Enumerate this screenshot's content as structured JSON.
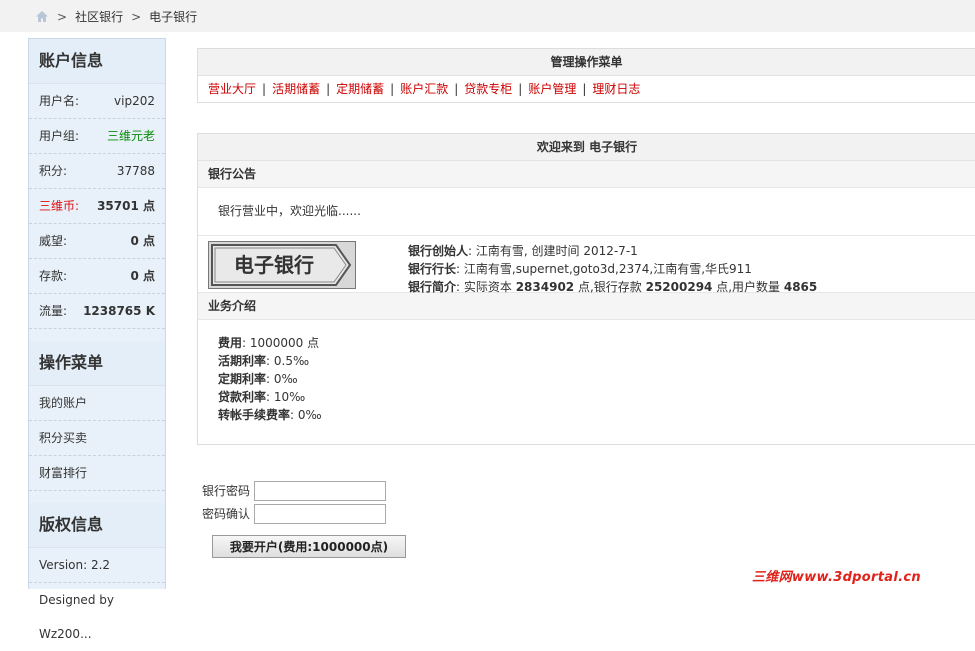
{
  "breadcrumb": {
    "items": [
      "社区银行",
      "电子银行"
    ],
    "sep": ">"
  },
  "sidebar": {
    "account": {
      "title": "账户信息",
      "rows": [
        {
          "k": "用户名:",
          "v": "vip202"
        },
        {
          "k": "用户组:",
          "v": "三维元老"
        },
        {
          "k": "积分:",
          "v": "37788"
        },
        {
          "k": "三维币:",
          "v": "35701 点"
        },
        {
          "k": "威望:",
          "v": "0 点"
        },
        {
          "k": "存款:",
          "v": "0 点"
        },
        {
          "k": "流量:",
          "v": "1238765 K"
        }
      ]
    },
    "ops": {
      "title": "操作菜单",
      "items": [
        "我的账户",
        "积分买卖",
        "财富排行"
      ]
    },
    "copyright": {
      "title": "版权信息",
      "version": "Version: 2.2",
      "designed": "Designed by Wz200..."
    }
  },
  "menu": {
    "title": "管理操作菜单",
    "items": [
      "营业大厅",
      "活期储蓄",
      "定期储蓄",
      "账户汇款",
      "贷款专柜",
      "账户管理",
      "理财日志"
    ],
    "divider": "|"
  },
  "welcome": {
    "title": "欢迎来到 电子银行",
    "notice_title": "银行公告",
    "notice": "银行营业中，欢迎光临......",
    "logo_text": "电子银行",
    "founder_label": "银行创始人",
    "founder": ": 江南有雪, 创建时间 2012-7-1",
    "president_label": "银行行长",
    "president": ": 江南有雪,supernet,goto3d,2374,江南有雪,华氏911",
    "intro_label": "银行简介",
    "intro_a": ": 实际资本 ",
    "capital": "2834902",
    "intro_b": " 点,银行存款 ",
    "deposit": "25200294",
    "intro_c": " 点,用户数量 ",
    "users": "4865",
    "biz_title": "业务介绍",
    "biz": [
      {
        "k": "费用",
        "v": ": 1000000 点"
      },
      {
        "k": "活期利率",
        "v": ": 0.5‰"
      },
      {
        "k": "定期利率",
        "v": ": 0‰"
      },
      {
        "k": "贷款利率",
        "v": ": 10‰"
      },
      {
        "k": "转帐手续费率",
        "v": ": 0‰"
      }
    ]
  },
  "form": {
    "pwd_label": "银行密码",
    "pwd_value": "",
    "confirm_label": "密码确认",
    "confirm_value": "",
    "submit": "我要开户(费用:1000000点)"
  },
  "watermark": "三维网www.3dportal.cn"
}
